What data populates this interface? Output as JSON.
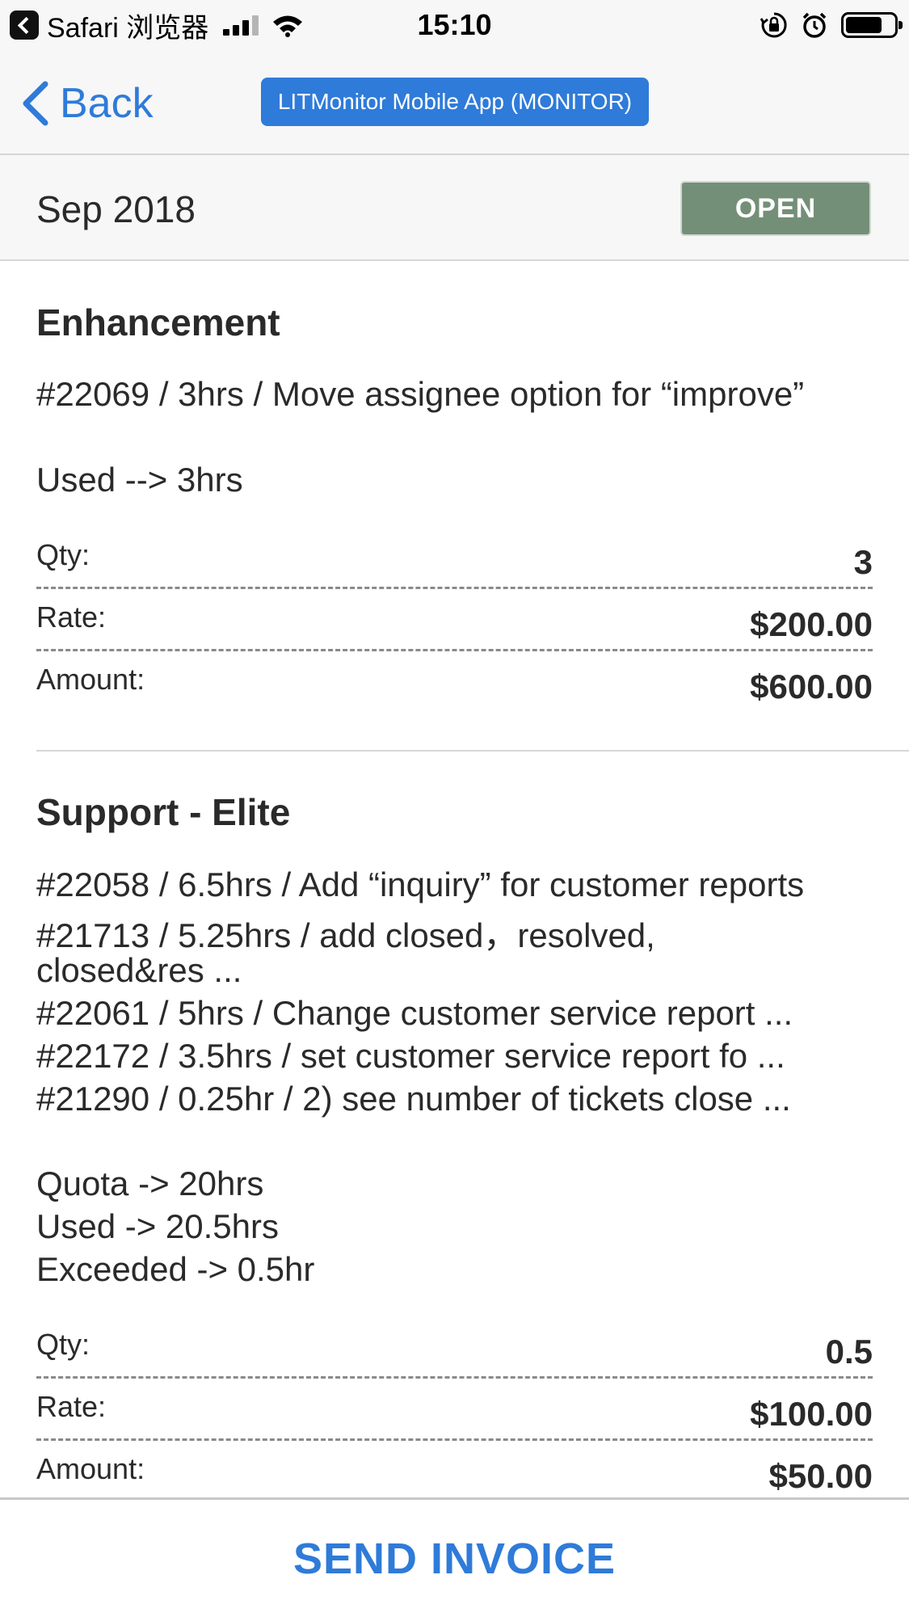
{
  "status_bar": {
    "app_name": "Safari 浏览器",
    "time": "15:10",
    "battery_level": 0.75
  },
  "nav": {
    "back_label": "Back",
    "app_title": "LITMonitor Mobile App (MONITOR)"
  },
  "period": {
    "label": "Sep 2018",
    "status": "OPEN",
    "status_color": "#748f78"
  },
  "sections": [
    {
      "title": "Enhancement",
      "lines": [
        "#22069 / 3hrs / Move assignee option for “improve”",
        "",
        "Used --> 3hrs"
      ],
      "fields": [
        {
          "label": "Qty:",
          "value": "3"
        },
        {
          "label": "Rate:",
          "value": "$200.00"
        },
        {
          "label": "Amount:",
          "value": "$600.00"
        }
      ]
    },
    {
      "title": "Support - Elite",
      "lines": [
        "#22058 / 6.5hrs / Add “inquiry” for customer reports",
        "#21713 / 5.25hrs / add closed，resolved,",
        "closed&res ...",
        "#22061 / 5hrs / Change customer service report ...",
        "#22172 / 3.5hrs / set customer service report fo ...",
        "#21290 / 0.25hr / 2) see number of tickets close ...",
        "",
        "Quota -> 20hrs",
        "Used -> 20.5hrs",
        "Exceeded -> 0.5hr"
      ],
      "fields": [
        {
          "label": "Qty:",
          "value": "0.5"
        },
        {
          "label": "Rate:",
          "value": "$100.00"
        },
        {
          "label": "Amount:",
          "value": "$50.00"
        }
      ]
    }
  ],
  "footer": {
    "send_label": "SEND INVOICE"
  },
  "colors": {
    "accent": "#2f7bd9",
    "status_open": "#748f78"
  }
}
